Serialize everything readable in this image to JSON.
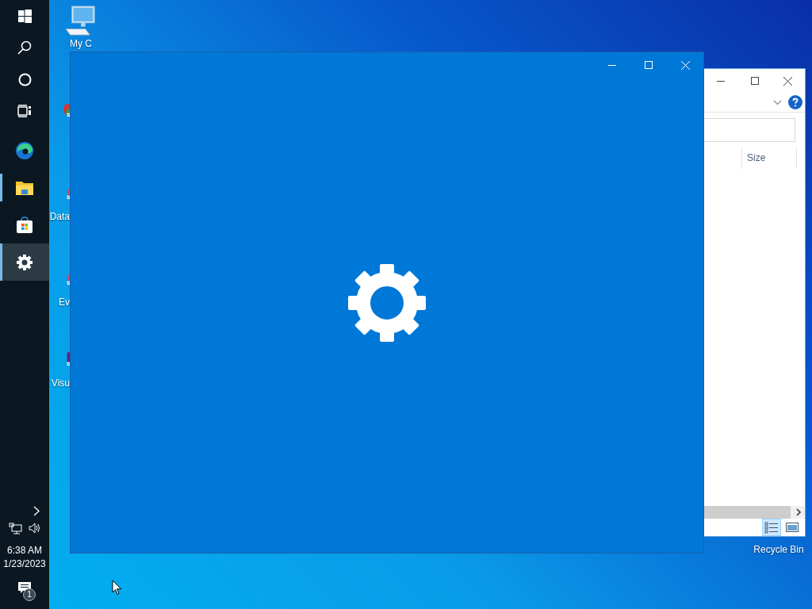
{
  "taskbar": {
    "buttons": [
      {
        "kind": "start"
      },
      {
        "kind": "search"
      },
      {
        "kind": "cortana"
      },
      {
        "kind": "task_view"
      }
    ],
    "apps": [
      {
        "kind": "edge",
        "running": false,
        "selected": false
      },
      {
        "kind": "explorer",
        "running": true,
        "selected": false
      },
      {
        "kind": "store",
        "running": false,
        "selected": false
      },
      {
        "kind": "settings",
        "running": true,
        "selected": true
      }
    ],
    "clock": {
      "time": "6:38 AM",
      "date": "1/23/2023"
    },
    "notifications": {
      "count": "1"
    }
  },
  "desktop_icons": [
    {
      "kind": "computer",
      "lines": [
        "My C"
      ]
    },
    {
      "kind": "chrome"
    },
    {
      "kind": "shortcut",
      "lines": [
        "Data"
      ]
    },
    {
      "kind": "shortcut",
      "lines": [
        "Ev"
      ]
    },
    {
      "kind": "visual",
      "lines": [
        "Visu"
      ]
    },
    {
      "kind": "recycle",
      "lines": [
        "Recycle Bin"
      ]
    }
  ],
  "explorer_window": {
    "column_header": "Size",
    "views": [
      {
        "kind": "details",
        "selected": true
      },
      {
        "kind": "large_icons",
        "selected": false
      }
    ]
  },
  "settings_window": {
    "loading": true
  }
}
